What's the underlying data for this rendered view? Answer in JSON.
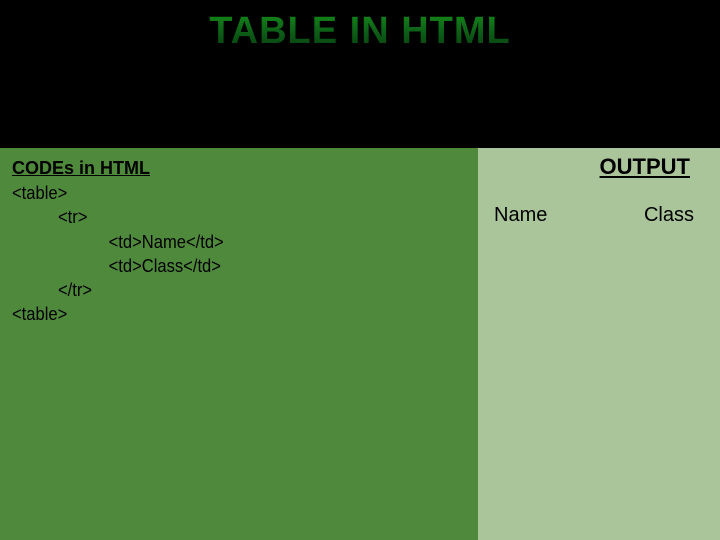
{
  "title": "TABLE IN HTML",
  "left": {
    "heading": "CODEs in HTML",
    "code": "<table>\n          <tr>\n                     <td>Name</td>\n                     <td>Class</td>\n          </tr>\n<table>"
  },
  "right": {
    "heading": "OUTPUT",
    "cells": [
      "Name",
      "Class"
    ]
  }
}
